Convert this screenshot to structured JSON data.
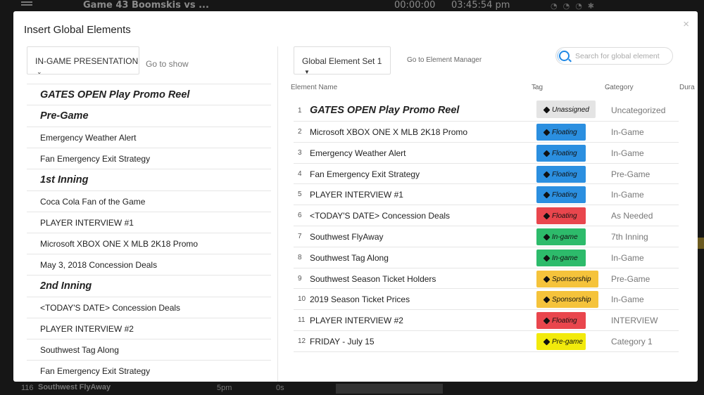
{
  "background": {
    "title": "Game 43 Boomskis vs ...",
    "timer": "00:00:00",
    "clock": "03:45:54 pm",
    "bottom_row": {
      "number": "116",
      "name": "Southwest FlyAway",
      "time": "5pm",
      "duration": "0s"
    }
  },
  "modal": {
    "title": "Insert Global Elements",
    "close": "×"
  },
  "left": {
    "show_select": "IN-GAME PRESENTATION",
    "goto_show": "Go to show",
    "rundown": [
      {
        "label": "GATES OPEN Play Promo Reel",
        "header": true
      },
      {
        "label": "Pre-Game",
        "header": true
      },
      {
        "label": "Emergency Weather Alert",
        "header": false
      },
      {
        "label": "Fan Emergency Exit Strategy",
        "header": false
      },
      {
        "label": "1st Inning",
        "header": true
      },
      {
        "label": "Coca Cola Fan of the Game",
        "header": false
      },
      {
        "label": "PLAYER INTERVIEW #1",
        "header": false
      },
      {
        "label": "Microsoft XBOX ONE X MLB 2K18 Promo",
        "header": false
      },
      {
        "label": "May 3, 2018 Concession Deals",
        "header": false
      },
      {
        "label": "2nd Inning",
        "header": true
      },
      {
        "label": "<TODAY'S DATE> Concession Deals",
        "header": false
      },
      {
        "label": "PLAYER INTERVIEW #2",
        "header": false
      },
      {
        "label": "Southwest Tag Along",
        "header": false
      },
      {
        "label": "Fan Emergency Exit Strategy",
        "header": false
      }
    ]
  },
  "right": {
    "set_select": "Global Element Set 1",
    "goto_manager": "Go to Element Manager",
    "search_placeholder": "Search for global element",
    "columns": {
      "name": "Element Name",
      "tag": "Tag",
      "category": "Category",
      "duration": "Dura"
    },
    "rows": [
      {
        "num": "1",
        "name": "GATES OPEN Play Promo Reel",
        "tag": "Unassigned",
        "tag_color": "#e4e4e4",
        "category": "Uncategorized"
      },
      {
        "num": "2",
        "name": "Microsoft XBOX ONE X MLB 2K18 Promo",
        "tag": "Floating",
        "tag_color": "#2b8fe0",
        "category": "In-Game"
      },
      {
        "num": "3",
        "name": "Emergency Weather Alert",
        "tag": "Floating",
        "tag_color": "#2b8fe0",
        "category": "In-Game"
      },
      {
        "num": "4",
        "name": "Fan Emergency Exit Strategy",
        "tag": "Floating",
        "tag_color": "#2b8fe0",
        "category": "Pre-Game"
      },
      {
        "num": "5",
        "name": "PLAYER INTERVIEW #1",
        "tag": "Floating",
        "tag_color": "#2b8fe0",
        "category": "In-Game"
      },
      {
        "num": "6",
        "name": "<TODAY'S DATE> Concession Deals",
        "tag": "Floating",
        "tag_color": "#e9464d",
        "category": "As Needed"
      },
      {
        "num": "7",
        "name": "Southwest FlyAway",
        "tag": "In-game",
        "tag_color": "#2dbb6b",
        "category": "7th Inning"
      },
      {
        "num": "8",
        "name": "Southwest Tag Along",
        "tag": "In-game",
        "tag_color": "#2dbb6b",
        "category": "In-Game"
      },
      {
        "num": "9",
        "name": "Southwest Season Ticket Holders",
        "tag": "Sponsorship",
        "tag_color": "#f5c33b",
        "category": "Pre-Game"
      },
      {
        "num": "10",
        "name": "2019 Season Ticket Prices",
        "tag": "Sponsorship",
        "tag_color": "#f5c33b",
        "category": "In-Game"
      },
      {
        "num": "11",
        "name": "PLAYER INTERVIEW #2",
        "tag": "Floating",
        "tag_color": "#e9464d",
        "category": "INTERVIEW"
      },
      {
        "num": "12",
        "name": "FRIDAY - July 15",
        "tag": "Pre-game",
        "tag_color": "#f2ea0c",
        "category": "Category 1"
      }
    ]
  }
}
